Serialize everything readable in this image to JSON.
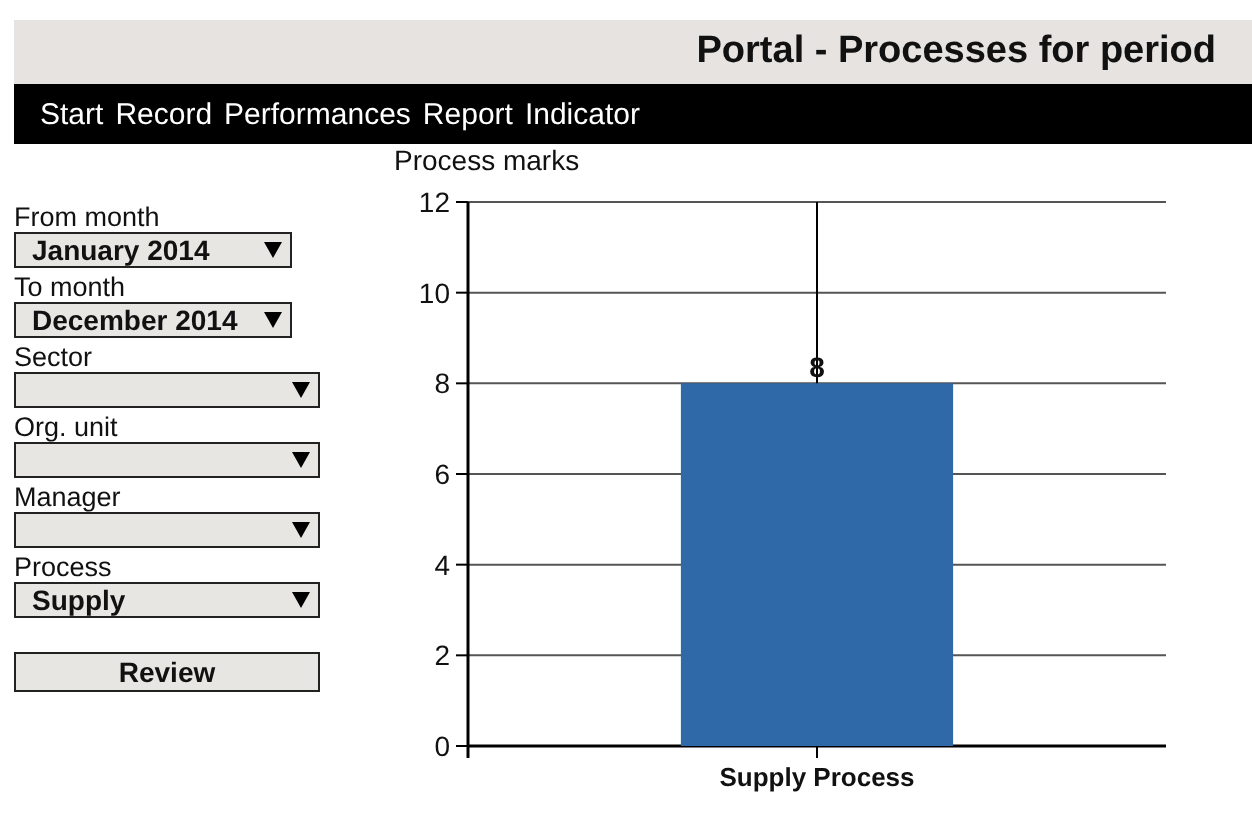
{
  "header": {
    "title": "Portal - Processes for period"
  },
  "nav": [
    "Start",
    "Record",
    "Performances",
    "Report",
    "Indicator"
  ],
  "filters": [
    {
      "label": "From month",
      "value": "January 2014",
      "kind": "narrow"
    },
    {
      "label": "To month",
      "value": "December 2014",
      "kind": "narrow"
    },
    {
      "label": "Sector",
      "kind": "wide"
    },
    {
      "label": "Org. unit",
      "kind": "wide"
    },
    {
      "label": "Manager",
      "kind": "wide"
    },
    {
      "label": "Process",
      "value": "Supply",
      "kind": "wide"
    }
  ],
  "review_button": "Review",
  "chart": {
    "chart_data": {
      "type": "bar",
      "title": "Process marks",
      "categories": [
        "Supply Process"
      ],
      "series": [
        {
          "color": "#2f69a8",
          "values": [
            8
          ]
        }
      ],
      "ylim": [
        0,
        12
      ],
      "yticks": [
        0,
        2,
        4,
        6,
        8,
        10,
        12
      ],
      "grid": true,
      "data_labels": true
    }
  }
}
